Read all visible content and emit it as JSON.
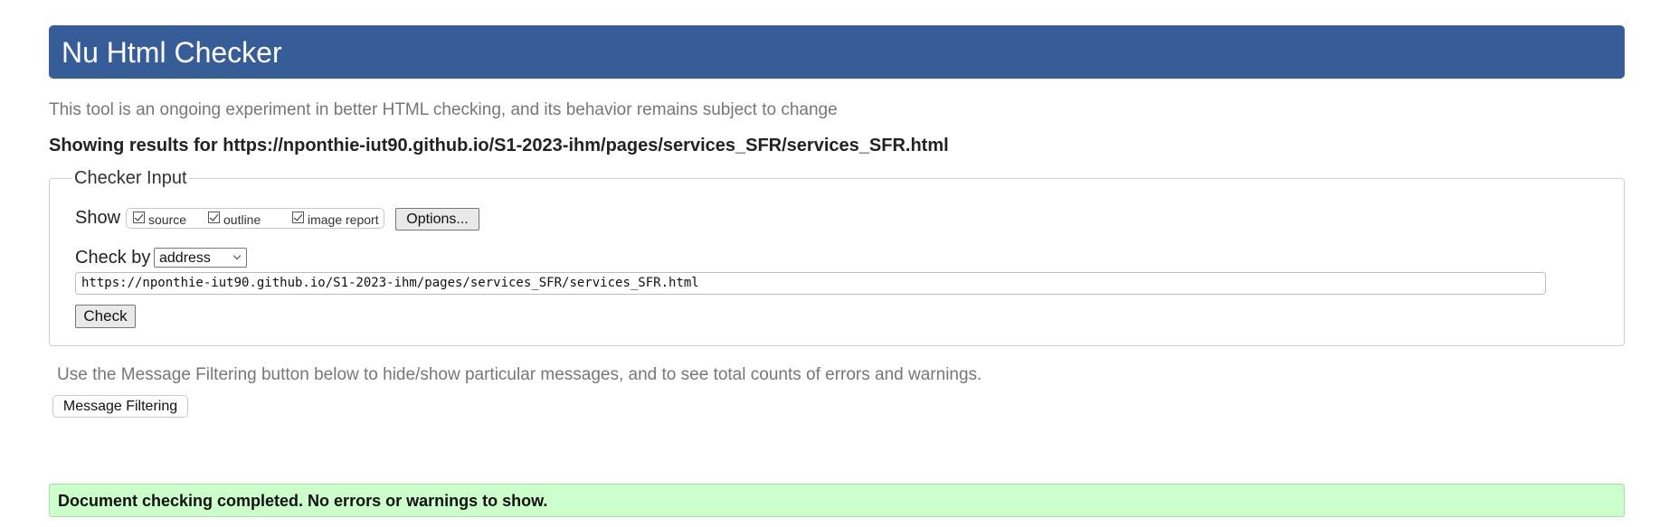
{
  "header": {
    "title": "Nu Html Checker",
    "accent_color": "#365d98"
  },
  "intro_text": "This tool is an ongoing experiment in better HTML checking, and its behavior remains subject to change",
  "results_heading": "Showing results for https://nponthie-iut90.github.io/S1-2023-ihm/pages/services_SFR/services_SFR.html",
  "checker_input": {
    "legend": "Checker Input",
    "show_label": "Show",
    "show_options": [
      {
        "label": "source",
        "checked": true
      },
      {
        "label": "outline",
        "checked": true
      },
      {
        "label": "image report",
        "checked": true
      }
    ],
    "options_button": "Options...",
    "check_by_label": "Check by",
    "check_by_value": "address",
    "url_value": "https://nponthie-iut90.github.io/S1-2023-ihm/pages/services_SFR/services_SFR.html",
    "check_button": "Check"
  },
  "filter": {
    "note": "Use the Message Filtering button below to hide/show particular messages, and to see total counts of errors and warnings.",
    "button": "Message Filtering"
  },
  "result": {
    "message": "Document checking completed. No errors or warnings to show.",
    "status_color": "#ccffcc"
  }
}
